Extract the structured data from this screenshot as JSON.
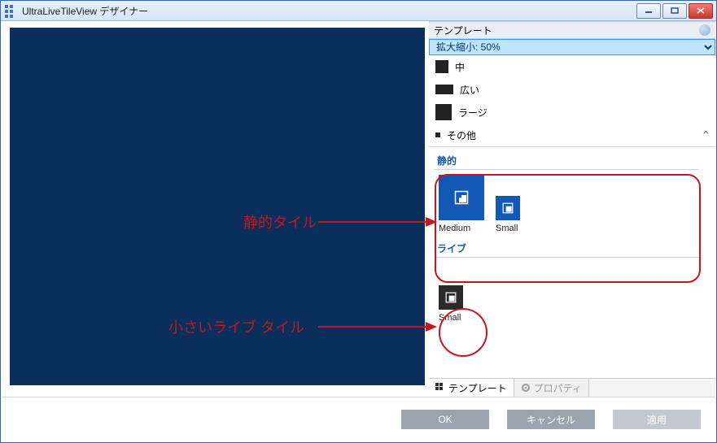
{
  "window": {
    "title": "UltraLiveTileView デザイナー"
  },
  "right_header": {
    "title": "テンプレート"
  },
  "zoom": {
    "selected": "拡大縮小: 50%"
  },
  "size_rows": {
    "medium": "中",
    "wide": "広い",
    "large": "ラージ",
    "other": "その他"
  },
  "groups": {
    "static": {
      "label": "静的",
      "tiles": {
        "medium": "Medium",
        "small": "Small"
      }
    },
    "live": {
      "label": "ライブ",
      "tiles": {
        "small": "Small"
      }
    }
  },
  "tabs": {
    "templates": "テンプレート",
    "properties": "プロパティ"
  },
  "footer": {
    "ok": "OK",
    "cancel": "キャンセル",
    "apply": "適用"
  },
  "annotations": {
    "static_tile": "静的タイル",
    "small_live_tile": "小さいライブ タイル"
  }
}
